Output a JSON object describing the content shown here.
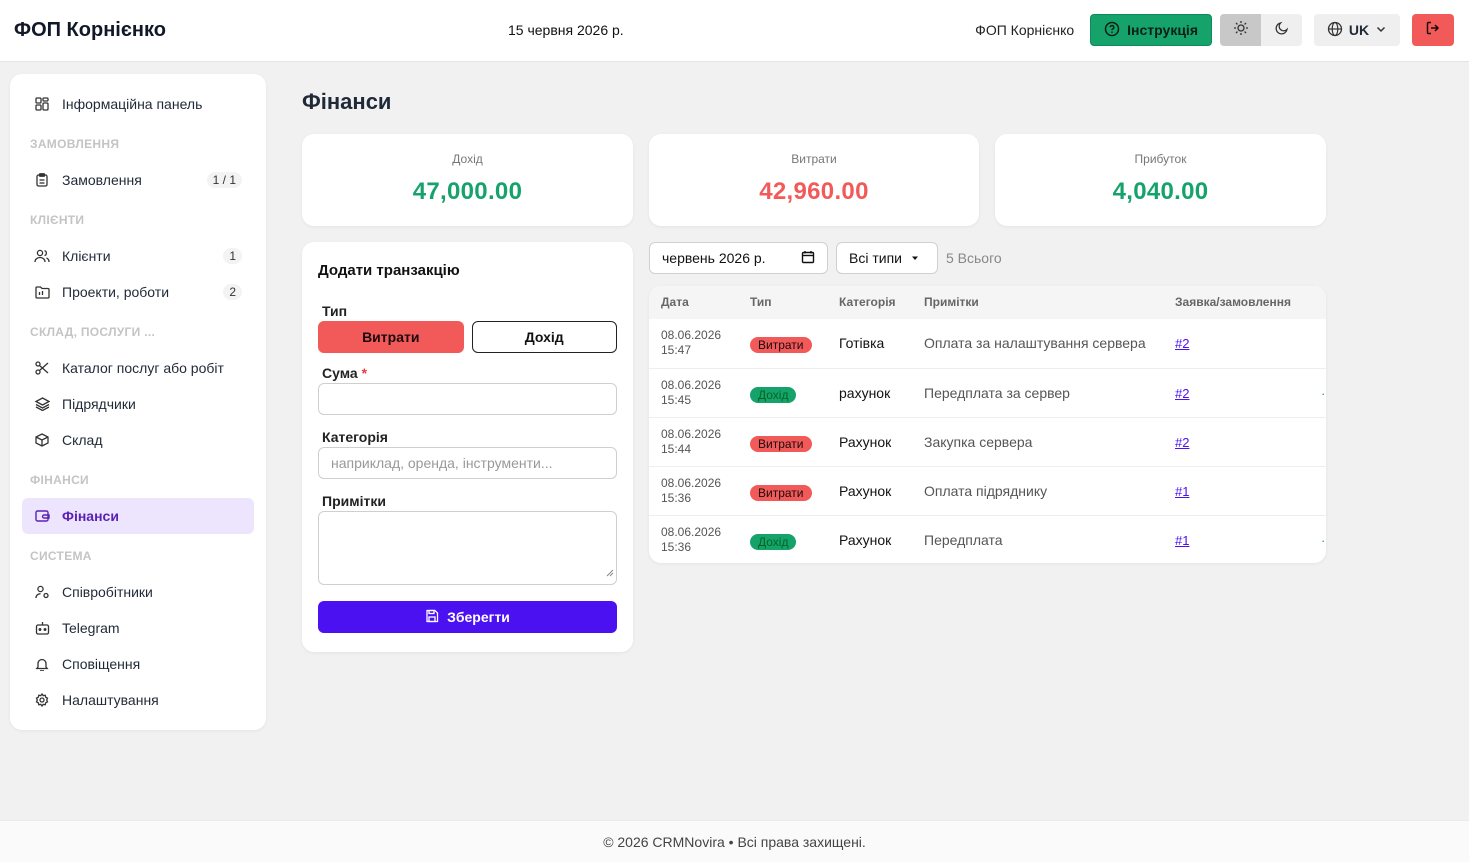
{
  "header": {
    "brand": "ФОП Корнієнко",
    "date": "15 червня 2026 р.",
    "user": "ФОП Корнієнко",
    "instruction_label": "Інструкція",
    "lang": "UK"
  },
  "sidebar": {
    "dashboard": "Інформаційна панель",
    "sections": {
      "orders": "ЗАМОВЛЕННЯ",
      "clients": "КЛІЄНТИ",
      "warehouse": "СКЛАД, ПОСЛУГИ ...",
      "finance": "ФІНАНСИ",
      "system": "СИСТЕМА"
    },
    "items": {
      "orders": "Замовлення",
      "orders_badge": "1 / 1",
      "clients": "Клієнти",
      "clients_badge": "1",
      "projects": "Проекти, роботи",
      "projects_badge": "2",
      "catalog": "Каталог послуг або робіт",
      "contractors": "Підрядчики",
      "warehouse": "Склад",
      "finance": "Фінанси",
      "employees": "Співробітники",
      "telegram": "Telegram",
      "notifications": "Сповіщення",
      "settings": "Налаштування"
    }
  },
  "page": {
    "title": "Фінанси"
  },
  "stats": {
    "income_label": "Дохід",
    "income_value": "47,000.00",
    "expenses_label": "Витрати",
    "expenses_value": "42,960.00",
    "profit_label": "Прибуток",
    "profit_value": "4,040.00",
    "income_color": "#16a36b",
    "expenses_color": "#f25a5a"
  },
  "form": {
    "title": "Додати транзакцію",
    "type_label": "Тип",
    "expense_btn": "Витрати",
    "income_btn": "Дохід",
    "amount_label": "Сума",
    "required_mark": "*",
    "category_label": "Категорія",
    "category_placeholder": "наприклад, оренда, інструменти...",
    "notes_label": "Примітки",
    "save_btn": "Зберегти"
  },
  "filters": {
    "month": "червень  2026 р.",
    "type": "Всі типи",
    "total": "5 Всього"
  },
  "table": {
    "headers": {
      "date": "Дата",
      "type": "Тип",
      "category": "Категорія",
      "notes": "Примітки",
      "order": "Заявка/замовлення"
    },
    "rows": [
      {
        "date": "08.06.2026",
        "time": "15:47",
        "type": "Витрати",
        "kind": "expense",
        "category": "Готівка",
        "note": "Оплата за налаштування сервера",
        "order": "#2",
        "trail": ""
      },
      {
        "date": "08.06.2026",
        "time": "15:45",
        "type": "Дохід",
        "kind": "income",
        "category": "рахунок",
        "note": "Передплата за сервер",
        "order": "#2",
        "trail": "·"
      },
      {
        "date": "08.06.2026",
        "time": "15:44",
        "type": "Витрати",
        "kind": "expense",
        "category": "Рахунок",
        "note": "Закупка сервера",
        "order": "#2",
        "trail": ""
      },
      {
        "date": "08.06.2026",
        "time": "15:36",
        "type": "Витрати",
        "kind": "expense",
        "category": "Рахунок",
        "note": "Оплата підряднику",
        "order": "#1",
        "trail": ""
      },
      {
        "date": "08.06.2026",
        "time": "15:36",
        "type": "Дохід",
        "kind": "income",
        "category": "Рахунок",
        "note": "Передплата",
        "order": "#1",
        "trail": "·"
      }
    ]
  },
  "footer": {
    "text": "© 2026 CRMNovira • Всі права захищені."
  }
}
